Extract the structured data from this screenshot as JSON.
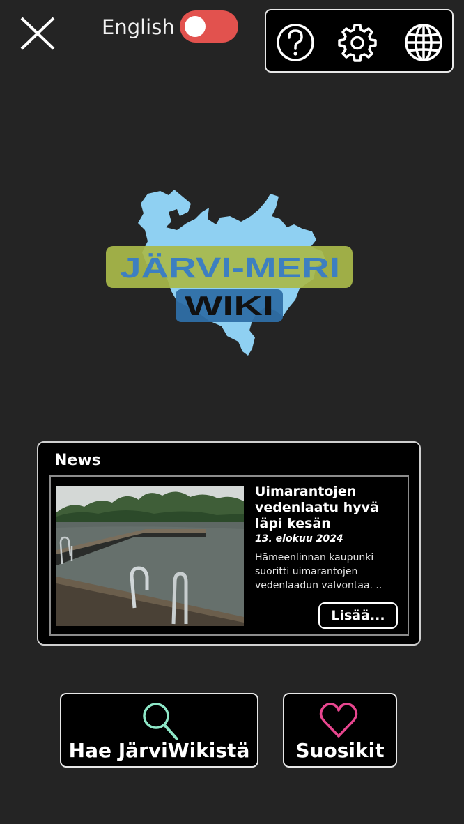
{
  "header": {
    "close_icon": "close-icon",
    "language_label": "English",
    "language_toggle": {
      "on": false,
      "track_color": "#e2524e"
    },
    "actions": [
      {
        "icon": "help-icon"
      },
      {
        "icon": "gear-icon"
      },
      {
        "icon": "globe-icon"
      }
    ]
  },
  "logo": {
    "line1": "JÄRVI-MERI",
    "line2": "WIKI",
    "colors": {
      "lake": "#8fd0f2",
      "band1": "#a9b94a",
      "text1": "#3d7fc0",
      "band2": "#2f6fa6",
      "text2": "#111111"
    }
  },
  "news": {
    "heading": "News",
    "article": {
      "title": "Uimarantojen vedenlaatu hyvä läpi kesän",
      "date": "13. elokuu 2024",
      "excerpt": "Hämeenlinnan kaupunki suoritti uimarantojen vedenlaadun valvontaa. ..",
      "more_label": "Lisää..."
    }
  },
  "buttons": {
    "search": {
      "label": "Hae JärviWikistä",
      "icon": "search-icon",
      "icon_color": "#8ee8c8"
    },
    "favorites": {
      "label": "Suosikit",
      "icon": "heart-icon",
      "icon_color": "#e8468f"
    }
  }
}
